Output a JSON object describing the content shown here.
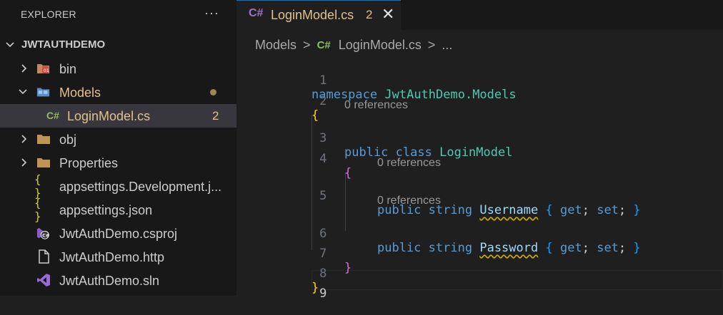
{
  "explorer": {
    "title": "EXPLORER",
    "more": "···",
    "root": "JWTAUTHDEMO",
    "items": [
      {
        "label": "bin",
        "icon": "bin-folder-icon"
      },
      {
        "label": "Models",
        "icon": "models-folder-icon"
      },
      {
        "label": "LoginModel.cs",
        "icon_text": "C#",
        "badge": "2"
      },
      {
        "label": "obj",
        "icon": "folder-icon"
      },
      {
        "label": "Properties",
        "icon": "folder-icon"
      },
      {
        "label": "appsettings.Development.j...",
        "icon_text": "{ }"
      },
      {
        "label": "appsettings.json",
        "icon_text": "{ }"
      },
      {
        "label": "JwtAuthDemo.csproj",
        "icon": "csproj-icon"
      },
      {
        "label": "JwtAuthDemo.http",
        "icon": "file-icon"
      },
      {
        "label": "JwtAuthDemo.sln",
        "icon": "visual-studio-icon"
      }
    ]
  },
  "tab": {
    "icon_text": "C#",
    "name": "LoginModel.cs",
    "count": "2",
    "close": "✕"
  },
  "breadcrumb": {
    "part1": "Models",
    "sep": ">",
    "icon_text": "C#",
    "part2": "LoginModel.cs",
    "ellipsis": "..."
  },
  "code": {
    "line_numbers": [
      "1",
      "2",
      "3",
      "4",
      "5",
      "6",
      "7",
      "8",
      "9"
    ],
    "lens": "0 references",
    "l1_kw": "namespace",
    "l1_ns": "JwtAuthDemo.Models",
    "open_brace": "{",
    "close_brace": "}",
    "public": "public",
    "class": "class",
    "class_name": "LoginModel",
    "string": "string",
    "prop1": "Username",
    "prop2": "Password",
    "get": "get",
    "set": "set",
    "semi": ";"
  },
  "colors": {
    "modified": "#e2c08d",
    "keyword": "#569cd6",
    "type": "#4ec9b0",
    "property": "#9cdcfe",
    "bracket1": "#ffd700",
    "bracket2": "#da70d6",
    "bracket3": "#179fff"
  }
}
